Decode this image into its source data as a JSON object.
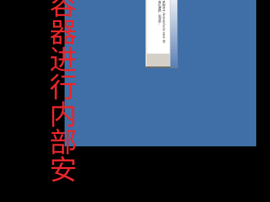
{
  "overlay_caption": "容器进行内部安",
  "dialog": {
    "lines": [
      "新建命令 /home/sfxc/z/ stem 40",
      "输出数据，请稍候...",
      ""
    ]
  },
  "colors": {
    "background": "#000000",
    "desktop": "#3f6fa6",
    "caption": "#e8262b",
    "dialog": "#d4d0c8"
  }
}
